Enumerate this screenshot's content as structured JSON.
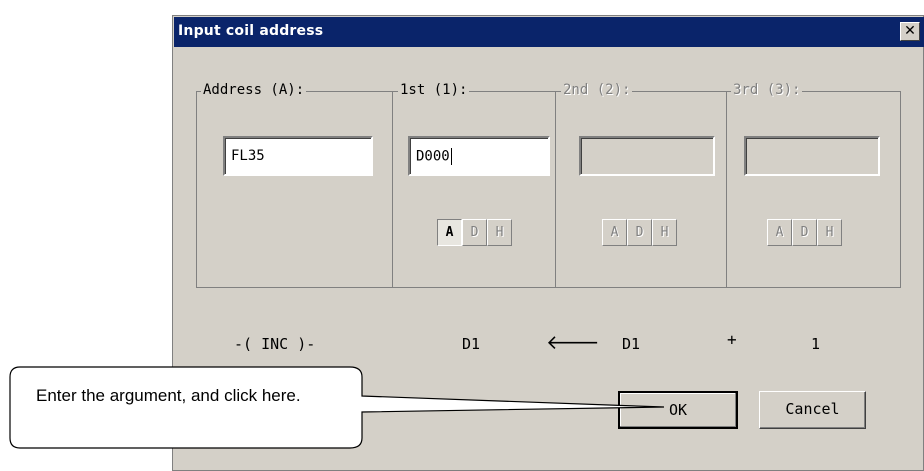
{
  "dialog": {
    "title": "Input coil address",
    "close_glyph": "✕"
  },
  "groups": {
    "address": {
      "label": "Address (A):",
      "value": "FL35"
    },
    "first": {
      "label": "1st (1):",
      "value": "D000",
      "radix": [
        "A",
        "D",
        "H"
      ],
      "selected_radix": "A"
    },
    "second": {
      "label": "2nd (2):",
      "value": "",
      "radix": [
        "A",
        "D",
        "H"
      ]
    },
    "third": {
      "label": "3rd (3):",
      "value": "",
      "radix": [
        "A",
        "D",
        "H"
      ]
    }
  },
  "formula": {
    "instruction": "-( INC )-",
    "dest": "D1",
    "arrow": "🡐",
    "src": "D1",
    "op": "+",
    "operand": "1"
  },
  "buttons": {
    "ok": "OK",
    "cancel": "Cancel"
  },
  "callout": {
    "text": "Enter the argument, and click here."
  }
}
